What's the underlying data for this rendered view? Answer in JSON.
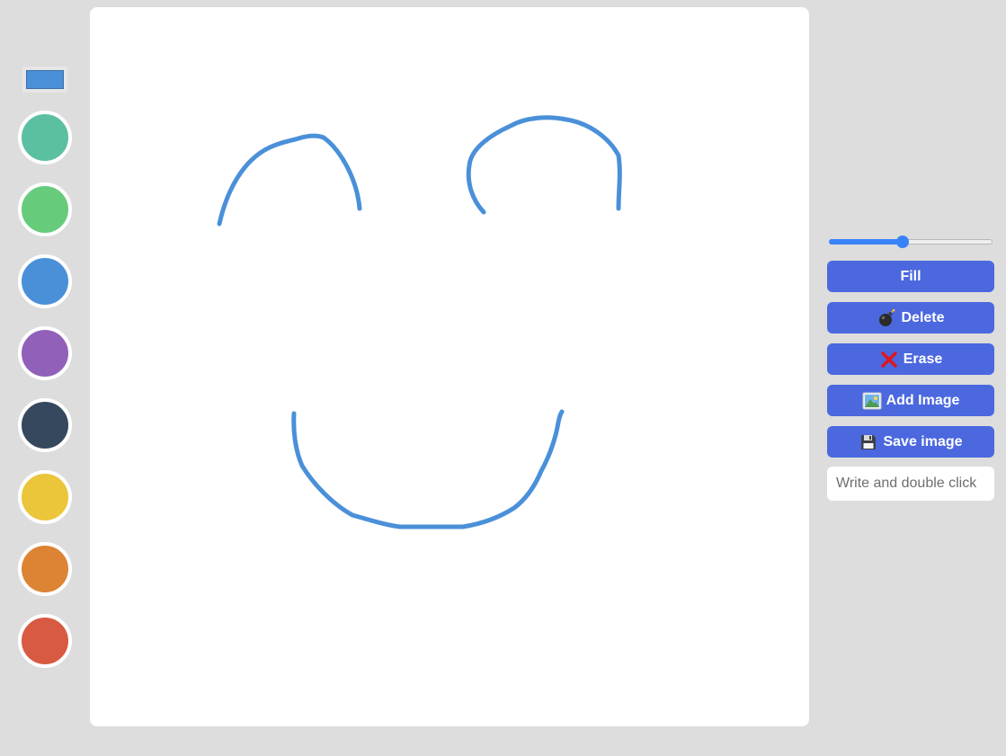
{
  "palette": {
    "current_color": "#4a90d9",
    "swatches": [
      {
        "name": "turquoise",
        "color": "#5bbfa2"
      },
      {
        "name": "green",
        "color": "#67cb7c"
      },
      {
        "name": "blue",
        "color": "#4a90d9"
      },
      {
        "name": "purple",
        "color": "#9160b8"
      },
      {
        "name": "navy",
        "color": "#35485e"
      },
      {
        "name": "yellow",
        "color": "#ebc53a"
      },
      {
        "name": "orange",
        "color": "#dc8434"
      },
      {
        "name": "red",
        "color": "#d85a43"
      }
    ]
  },
  "canvas": {
    "background": "#ffffff",
    "stroke_color": "#4a90d9"
  },
  "controls": {
    "brush_size_fraction": 0.45,
    "buttons": [
      {
        "key": "fill",
        "label": "Fill",
        "icon": ""
      },
      {
        "key": "delete",
        "label": "Delete",
        "icon": "bomb-icon"
      },
      {
        "key": "erase",
        "label": "Erase",
        "icon": "cross-mark-icon"
      },
      {
        "key": "add-image",
        "label": "Add Image",
        "icon": "picture-icon"
      },
      {
        "key": "save-image",
        "label": "Save image",
        "icon": "floppy-disk-icon"
      }
    ],
    "text_input": {
      "value": "",
      "placeholder": "Write and double click"
    },
    "button_color": "#4b68df"
  }
}
